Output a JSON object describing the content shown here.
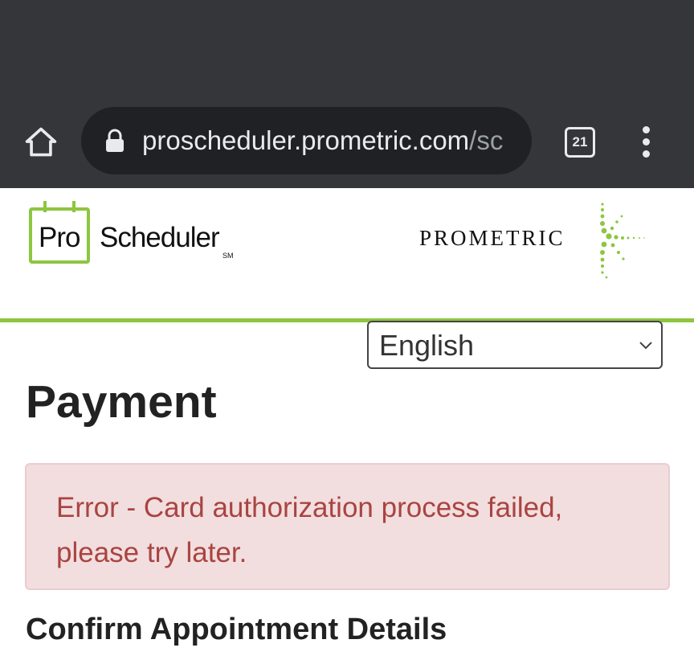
{
  "browser": {
    "url_domain": "proscheduler.prometric.com",
    "url_path": "/sc",
    "tab_count": "21",
    "icons": {
      "home": "home-icon",
      "lock": "lock-icon",
      "tabs": "tab-switcher-icon",
      "menu": "more-vert-icon"
    }
  },
  "header": {
    "logo_pro": "Pro",
    "logo_scheduler": "Scheduler",
    "logo_sm": "SM",
    "brand_name": "PROMETRIC"
  },
  "language_select": {
    "selected": "English"
  },
  "main": {
    "title": "Payment",
    "error_message": "Error - Card authorization process failed, please try later.",
    "section_heading": "Confirm Appointment Details"
  },
  "colors": {
    "chrome_bg": "#35363a",
    "urlbar_bg": "#202124",
    "accent_green": "#8dc63f",
    "alert_bg": "#f2dede",
    "alert_border": "#ebccd1",
    "alert_text": "#a94442"
  }
}
